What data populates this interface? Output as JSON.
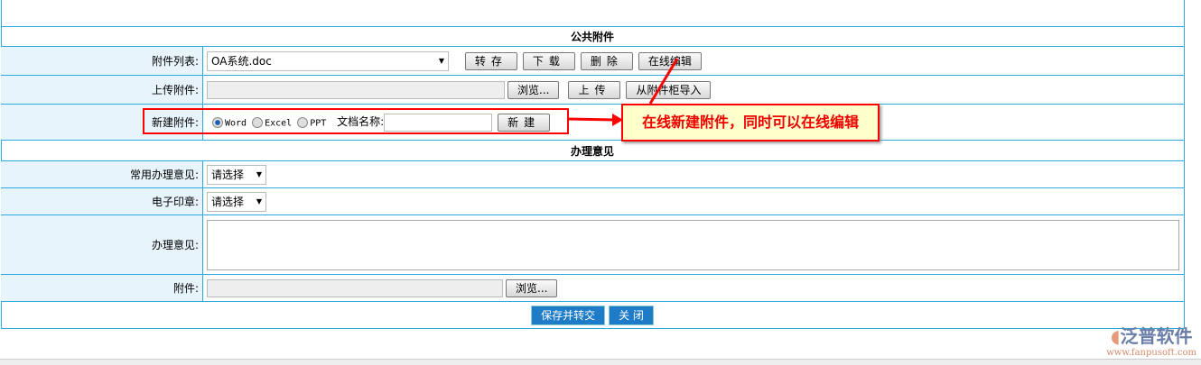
{
  "public_attachments": {
    "title": "公共附件",
    "list_label": "附件列表:",
    "list_value": "OA系统.doc",
    "save_btn": "转存",
    "download_btn": "下载",
    "delete_btn": "删除",
    "edit_online_btn": "在线编辑",
    "upload_label": "上传附件:",
    "browse_btn": "浏览...",
    "upload_btn": "上传",
    "import_btn": "从附件柜导入",
    "new_label": "新建附件:",
    "types": [
      "Word",
      "Excel",
      "PPT"
    ],
    "selected_type": "Word",
    "docname_label": "文档名称:",
    "docname_value": "",
    "new_btn": "新建"
  },
  "processing": {
    "title": "办理意见",
    "common_label": "常用办理意见:",
    "common_value": "请选择",
    "seal_label": "电子印章:",
    "seal_value": "请选择",
    "opinion_label": "办理意见:",
    "opinion_value": "",
    "attach_label": "附件:",
    "browse_btn": "浏览..."
  },
  "actions": {
    "submit": "保存并转交",
    "close": "关 闭"
  },
  "annotation": "在线新建附件，同时可以在线编辑",
  "logo": {
    "name": "泛普软件",
    "url": "www.fanpusoft.com"
  }
}
